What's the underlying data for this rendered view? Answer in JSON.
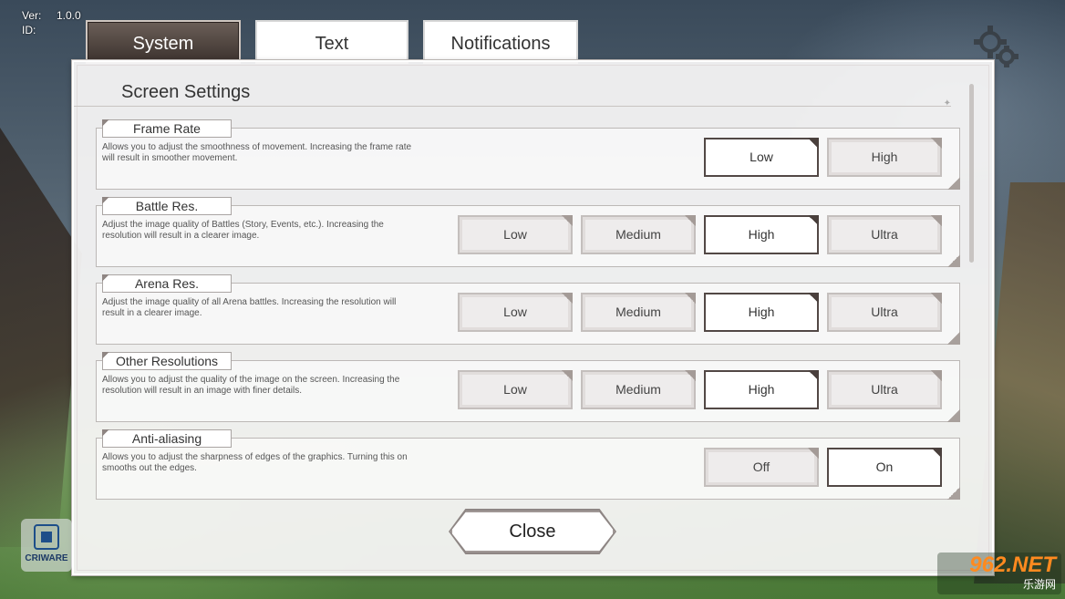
{
  "version": {
    "label": "Ver:",
    "value": "1.0.0",
    "id_label": "ID:"
  },
  "tabs": [
    {
      "label": "System",
      "selected": true
    },
    {
      "label": "Text",
      "selected": false
    },
    {
      "label": "Notifications",
      "selected": false
    }
  ],
  "panel": {
    "title": "Screen Settings"
  },
  "settings": [
    {
      "label": "Frame Rate",
      "description": "Allows you to adjust the smoothness of movement. Increasing the frame rate will result in smoother movement.",
      "options": [
        "Low",
        "High"
      ],
      "selected": "Low"
    },
    {
      "label": "Battle Res.",
      "description": "Adjust the image quality of Battles (Story, Events, etc.). Increasing the resolution will result in a clearer image.",
      "options": [
        "Low",
        "Medium",
        "High",
        "Ultra"
      ],
      "selected": "High"
    },
    {
      "label": "Arena Res.",
      "description": "Adjust the image quality of all Arena battles. Increasing the resolution will result in a clearer image.",
      "options": [
        "Low",
        "Medium",
        "High",
        "Ultra"
      ],
      "selected": "High"
    },
    {
      "label": "Other Resolutions",
      "description": "Allows you to adjust the quality of the image on the screen. Increasing the resolution will result in an image with finer details.",
      "options": [
        "Low",
        "Medium",
        "High",
        "Ultra"
      ],
      "selected": "High"
    },
    {
      "label": "Anti-aliasing",
      "description": "Allows you to adjust the sharpness of edges of the graphics. Turning this on smooths out the edges.",
      "options": [
        "Off",
        "On"
      ],
      "selected": "On"
    }
  ],
  "close_label": "Close",
  "criware_label": "CRIWARE",
  "watermark": {
    "top": "962.NET",
    "bottom": "乐游网"
  },
  "icons": {
    "settings": "gear-icon",
    "criware": "criware-logo-icon"
  },
  "colors": {
    "selected_border": "#524845",
    "tab_active": "#3c322e",
    "panel_bg": "#f6f5f5"
  }
}
